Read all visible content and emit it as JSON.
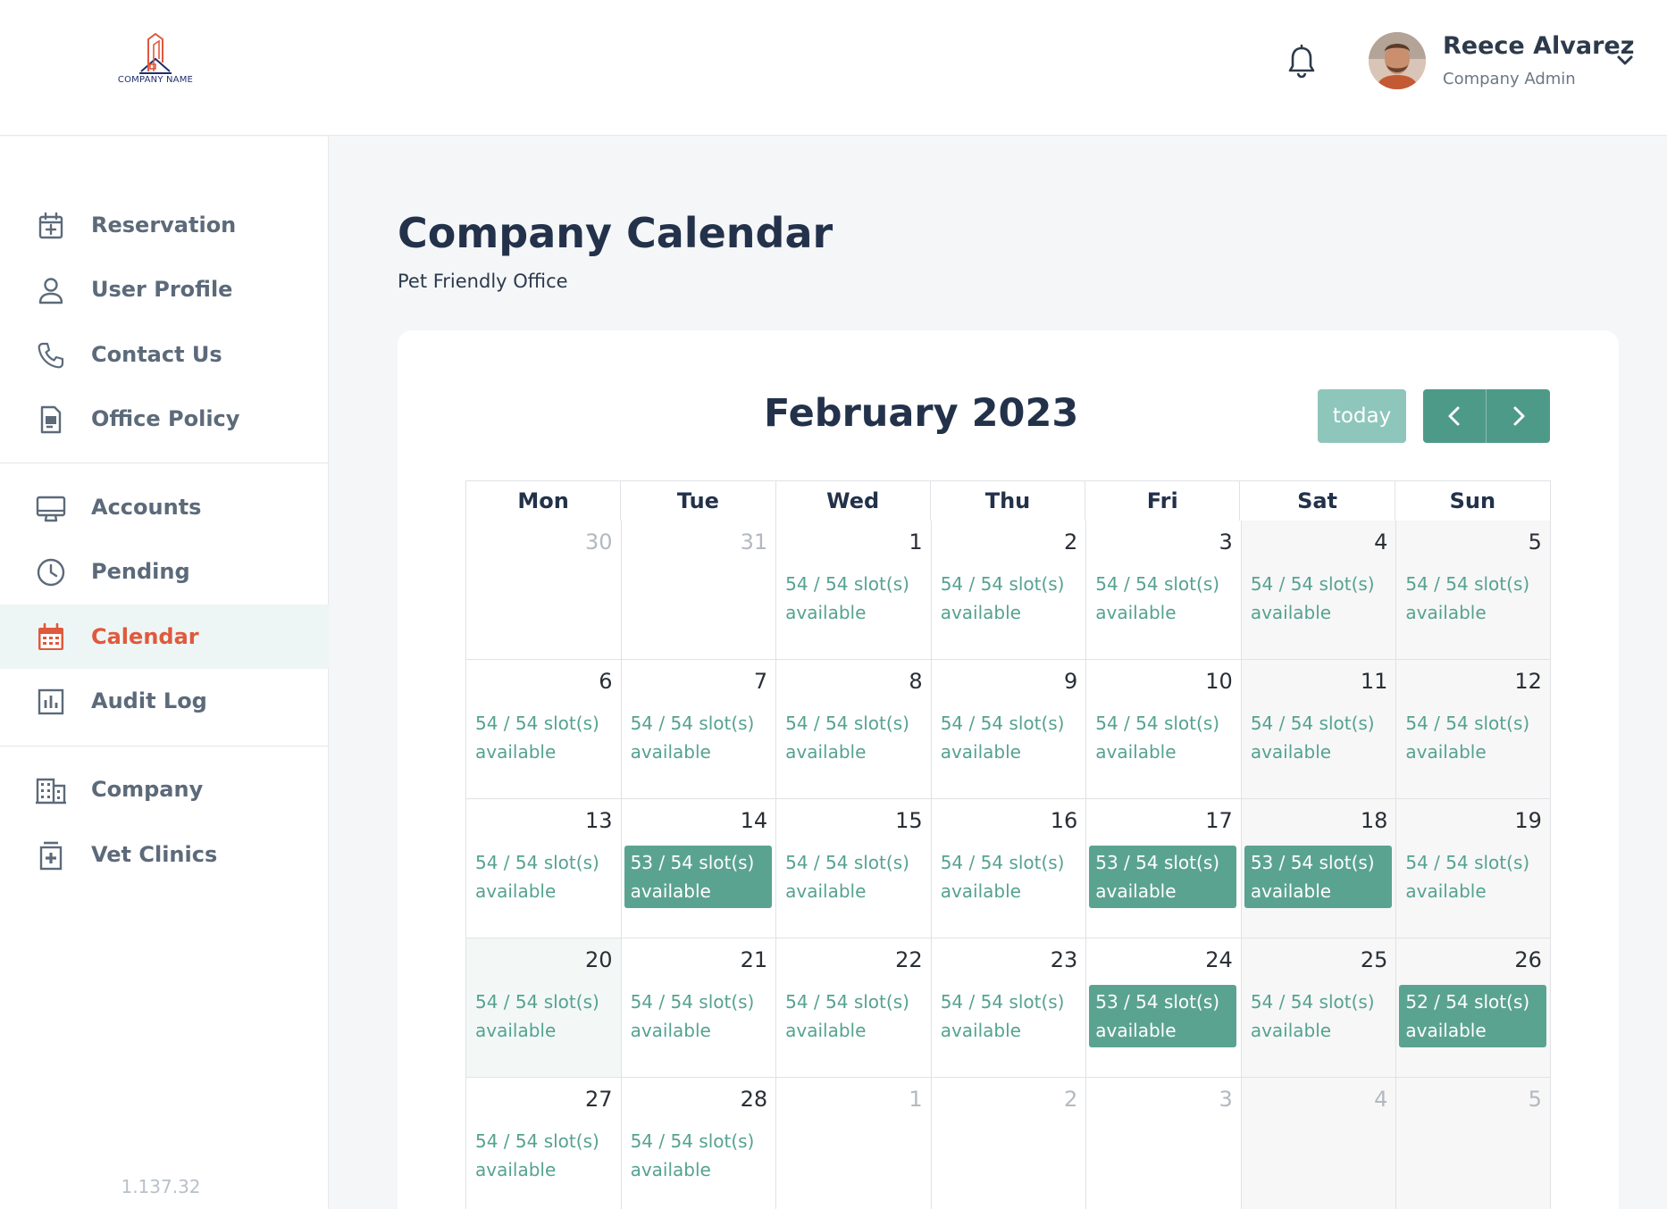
{
  "header": {
    "logo_text": "COMPANY NAME",
    "user_name": "Reece Alvarez",
    "user_role": "Company Admin"
  },
  "sidebar": {
    "groups": [
      [
        {
          "label": "Reservation",
          "icon": "calendar-plus-icon"
        },
        {
          "label": "User Profile",
          "icon": "user-icon"
        },
        {
          "label": "Contact Us",
          "icon": "phone-icon"
        },
        {
          "label": "Office Policy",
          "icon": "document-icon"
        }
      ],
      [
        {
          "label": "Accounts",
          "icon": "monitor-icon"
        },
        {
          "label": "Pending",
          "icon": "clock-icon"
        },
        {
          "label": "Calendar",
          "icon": "calendar-icon",
          "active": true
        },
        {
          "label": "Audit Log",
          "icon": "bar-chart-icon"
        }
      ],
      [
        {
          "label": "Company",
          "icon": "building-icon"
        },
        {
          "label": "Vet Clinics",
          "icon": "clinic-icon"
        }
      ]
    ],
    "version": "1.137.32"
  },
  "main": {
    "title": "Company Calendar",
    "subtitle": "Pet Friendly Office"
  },
  "calendar": {
    "month_title": "February 2023",
    "today_label": "today",
    "weekdays": [
      "Mon",
      "Tue",
      "Wed",
      "Thu",
      "Fri",
      "Sat",
      "Sun"
    ],
    "weeks": [
      [
        {
          "day": "30",
          "other": true
        },
        {
          "day": "31",
          "other": true
        },
        {
          "day": "1",
          "slot": "54 / 54 slot(s) available"
        },
        {
          "day": "2",
          "slot": "54 / 54 slot(s) available"
        },
        {
          "day": "3",
          "slot": "54 / 54 slot(s) available"
        },
        {
          "day": "4",
          "slot": "54 / 54 slot(s) available",
          "weekend": true
        },
        {
          "day": "5",
          "slot": "54 / 54 slot(s) available",
          "weekend": true
        }
      ],
      [
        {
          "day": "6",
          "slot": "54 / 54 slot(s) available"
        },
        {
          "day": "7",
          "slot": "54 / 54 slot(s) available"
        },
        {
          "day": "8",
          "slot": "54 / 54 slot(s) available"
        },
        {
          "day": "9",
          "slot": "54 / 54 slot(s) available"
        },
        {
          "day": "10",
          "slot": "54 / 54 slot(s) available"
        },
        {
          "day": "11",
          "slot": "54 / 54 slot(s) available",
          "weekend": true
        },
        {
          "day": "12",
          "slot": "54 / 54 slot(s) available",
          "weekend": true
        }
      ],
      [
        {
          "day": "13",
          "slot": "54 / 54 slot(s) available"
        },
        {
          "day": "14",
          "slot": "53 / 54 slot(s) available",
          "booked": true
        },
        {
          "day": "15",
          "slot": "54 / 54 slot(s) available"
        },
        {
          "day": "16",
          "slot": "54 / 54 slot(s) available"
        },
        {
          "day": "17",
          "slot": "53 / 54 slot(s) available",
          "booked": true
        },
        {
          "day": "18",
          "slot": "53 / 54 slot(s) available",
          "booked": true,
          "weekend": true
        },
        {
          "day": "19",
          "slot": "54 / 54 slot(s) available",
          "weekend": true
        }
      ],
      [
        {
          "day": "20",
          "slot": "54 / 54 slot(s) available",
          "today": true
        },
        {
          "day": "21",
          "slot": "54 / 54 slot(s) available"
        },
        {
          "day": "22",
          "slot": "54 / 54 slot(s) available"
        },
        {
          "day": "23",
          "slot": "54 / 54 slot(s) available"
        },
        {
          "day": "24",
          "slot": "53 / 54 slot(s) available",
          "booked": true
        },
        {
          "day": "25",
          "slot": "54 / 54 slot(s) available",
          "weekend": true
        },
        {
          "day": "26",
          "slot": "52 / 54 slot(s) available",
          "booked": true,
          "weekend": true
        }
      ],
      [
        {
          "day": "27",
          "slot": "54 / 54 slot(s) available"
        },
        {
          "day": "28",
          "slot": "54 / 54 slot(s) available"
        },
        {
          "day": "1",
          "other": true
        },
        {
          "day": "2",
          "other": true
        },
        {
          "day": "3",
          "other": true
        },
        {
          "day": "4",
          "other": true,
          "weekend": true
        },
        {
          "day": "5",
          "other": true,
          "weekend": true
        }
      ]
    ]
  },
  "colors": {
    "accent": "#4e9a88",
    "active_nav": "#e0593d",
    "slot_text": "#55a290",
    "slot_booked_bg": "#5ba391"
  }
}
